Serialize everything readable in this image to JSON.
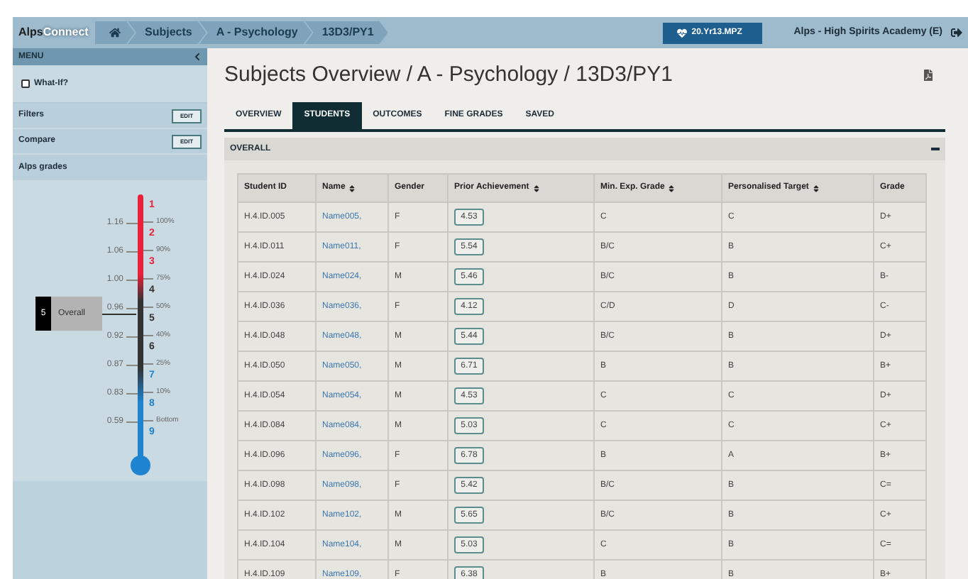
{
  "header": {
    "logo": {
      "part1": "Alps",
      "part2": "Connect"
    },
    "breadcrumbs": [
      "Subjects",
      "A - Psychology",
      "13D3/PY1"
    ],
    "badge": "20.Yr13.MPZ",
    "school": "Alps - High Spirits Academy (E)"
  },
  "sidebar": {
    "menu_title": "MENU",
    "what_if": {
      "label": "What-If?",
      "checked": false
    },
    "sections": [
      {
        "label": "Filters",
        "button": "EDIT"
      },
      {
        "label": "Compare",
        "button": "EDIT"
      }
    ],
    "grades_title": "Alps grades",
    "scale": {
      "left_ticks": [
        "1.16",
        "1.06",
        "1.00",
        "0.96",
        "0.92",
        "0.87",
        "0.83",
        "0.59"
      ],
      "right_ticks": [
        "100%",
        "90%",
        "75%",
        "50%",
        "40%",
        "25%",
        "10%",
        "Bottom"
      ],
      "grades": [
        {
          "label": "1",
          "color": "#e8203a"
        },
        {
          "label": "2",
          "color": "#e8203a"
        },
        {
          "label": "3",
          "color": "#e8203a"
        },
        {
          "label": "4",
          "color": "#333333"
        },
        {
          "label": "5",
          "color": "#333333"
        },
        {
          "label": "6",
          "color": "#333333"
        },
        {
          "label": "7",
          "color": "#1f84d0"
        },
        {
          "label": "8",
          "color": "#1f84d0"
        },
        {
          "label": "9",
          "color": "#1f84d0"
        }
      ],
      "marker": {
        "grade": "5",
        "label": "Overall"
      }
    }
  },
  "main": {
    "title": "Subjects Overview / A - Psychology / 13D3/PY1",
    "tabs": [
      {
        "label": "OVERVIEW",
        "selected": false
      },
      {
        "label": "STUDENTS",
        "selected": true
      },
      {
        "label": "OUTCOMES",
        "selected": false
      },
      {
        "label": "FINE GRADES",
        "selected": false
      },
      {
        "label": "SAVED",
        "selected": false
      }
    ],
    "panel": {
      "title": "OVERALL",
      "expanded": true
    },
    "table": {
      "columns": [
        {
          "label": "Student ID",
          "sortable": false
        },
        {
          "label": "Name",
          "sortable": true
        },
        {
          "label": "Gender",
          "sortable": false
        },
        {
          "label": "Prior Achievement",
          "sortable": true
        },
        {
          "label": "Min. Exp. Grade",
          "sortable": true
        },
        {
          "label": "Personalised Target",
          "sortable": true
        },
        {
          "label": "Grade",
          "sortable": false
        }
      ],
      "rows": [
        [
          "H.4.ID.005",
          "Name005,",
          "F",
          "4.53",
          "C",
          "C",
          "D+"
        ],
        [
          "H.4.ID.011",
          "Name011,",
          "F",
          "5.54",
          "B/C",
          "B",
          "C+"
        ],
        [
          "H.4.ID.024",
          "Name024,",
          "M",
          "5.46",
          "B/C",
          "B",
          "B-"
        ],
        [
          "H.4.ID.036",
          "Name036,",
          "F",
          "4.12",
          "C/D",
          "D",
          "C-"
        ],
        [
          "H.4.ID.048",
          "Name048,",
          "M",
          "5.44",
          "B/C",
          "B",
          "D+"
        ],
        [
          "H.4.ID.050",
          "Name050,",
          "M",
          "6.71",
          "B",
          "B",
          "B+"
        ],
        [
          "H.4.ID.054",
          "Name054,",
          "M",
          "4.53",
          "C",
          "C",
          "D+"
        ],
        [
          "H.4.ID.084",
          "Name084,",
          "M",
          "5.03",
          "C",
          "C",
          "C+"
        ],
        [
          "H.4.ID.096",
          "Name096,",
          "F",
          "6.78",
          "B",
          "A",
          "B+"
        ],
        [
          "H.4.ID.098",
          "Name098,",
          "F",
          "5.42",
          "B/C",
          "B",
          "C="
        ],
        [
          "H.4.ID.102",
          "Name102,",
          "M",
          "5.65",
          "B/C",
          "B",
          "C+"
        ],
        [
          "H.4.ID.104",
          "Name104,",
          "M",
          "5.03",
          "C",
          "B",
          "C="
        ],
        [
          "H.4.ID.109",
          "Name109,",
          "F",
          "6.38",
          "B",
          "B",
          "B+"
        ]
      ]
    }
  }
}
